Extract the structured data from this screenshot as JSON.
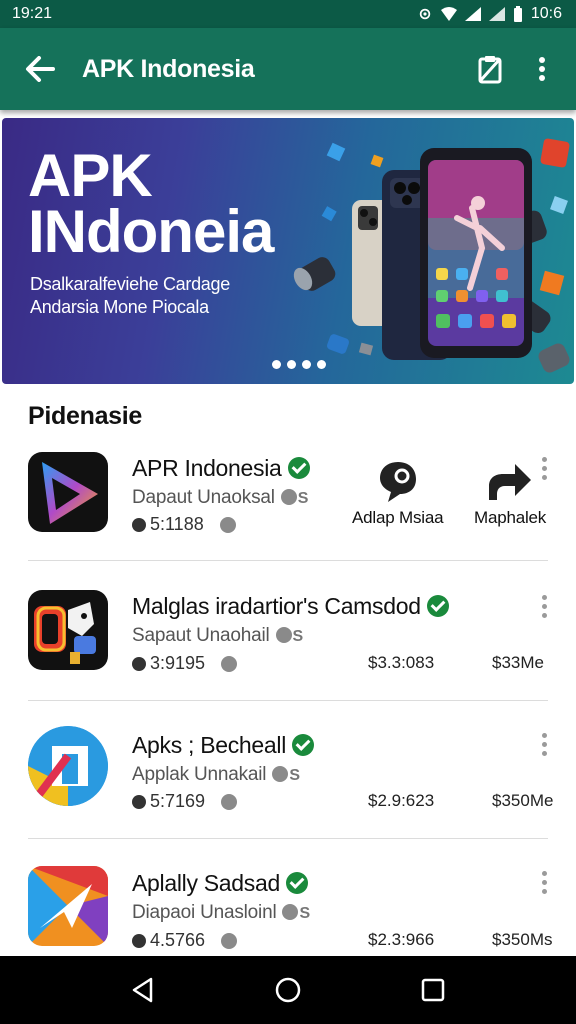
{
  "status_bar": {
    "time_left": "19:21",
    "time_right": "10:6",
    "icons": [
      "settings-icon",
      "wifi-icon",
      "signal-icon",
      "signal-icon",
      "battery-icon"
    ]
  },
  "app_bar": {
    "title": "APK Indonesia",
    "back_icon": "arrow-left-icon",
    "actions": [
      "clipboard-icon",
      "more-vert-icon"
    ]
  },
  "banner": {
    "title_line1": "APK",
    "title_line2": "INdoneia",
    "subtitle_line1": "Dsalkaralfeviehe Cardage",
    "subtitle_line2": "Andarsia Mone Piocala",
    "page_count": 4,
    "active_page": 1
  },
  "section": {
    "title": "Pidenasie"
  },
  "apps": [
    {
      "name": "APR Indonesia",
      "developer": "Dapaut Unaoksal",
      "badge": "S",
      "rating": "5:1188",
      "action1_label": "Adlap Msiaa",
      "action2_label": "Maphalek"
    },
    {
      "name": "Malglas iradartior's Camsdod",
      "developer": "Sapaut Unaohail",
      "badge": "S",
      "rating": "3:9195",
      "price1": "$3.3:083",
      "price2": "$33Me"
    },
    {
      "name": "Apks ; Becheall",
      "developer": "Applak Unnakail",
      "badge": "S",
      "rating": "5:7169",
      "price1": "$2.9:623",
      "price2": "$350Me"
    },
    {
      "name": "Aplally Sadsad",
      "developer": "Diapaoi Unasloinl",
      "badge": "S",
      "rating": "4.5766",
      "price1": "$2.3:966",
      "price2": "$350Ms"
    }
  ],
  "nav_bar": {
    "icons": [
      "back-triangle-icon",
      "home-circle-icon",
      "recents-square-icon"
    ]
  },
  "colors": {
    "status_bar": "#0c5a46",
    "app_bar": "#15725a",
    "verified": "#1a8a3c"
  }
}
